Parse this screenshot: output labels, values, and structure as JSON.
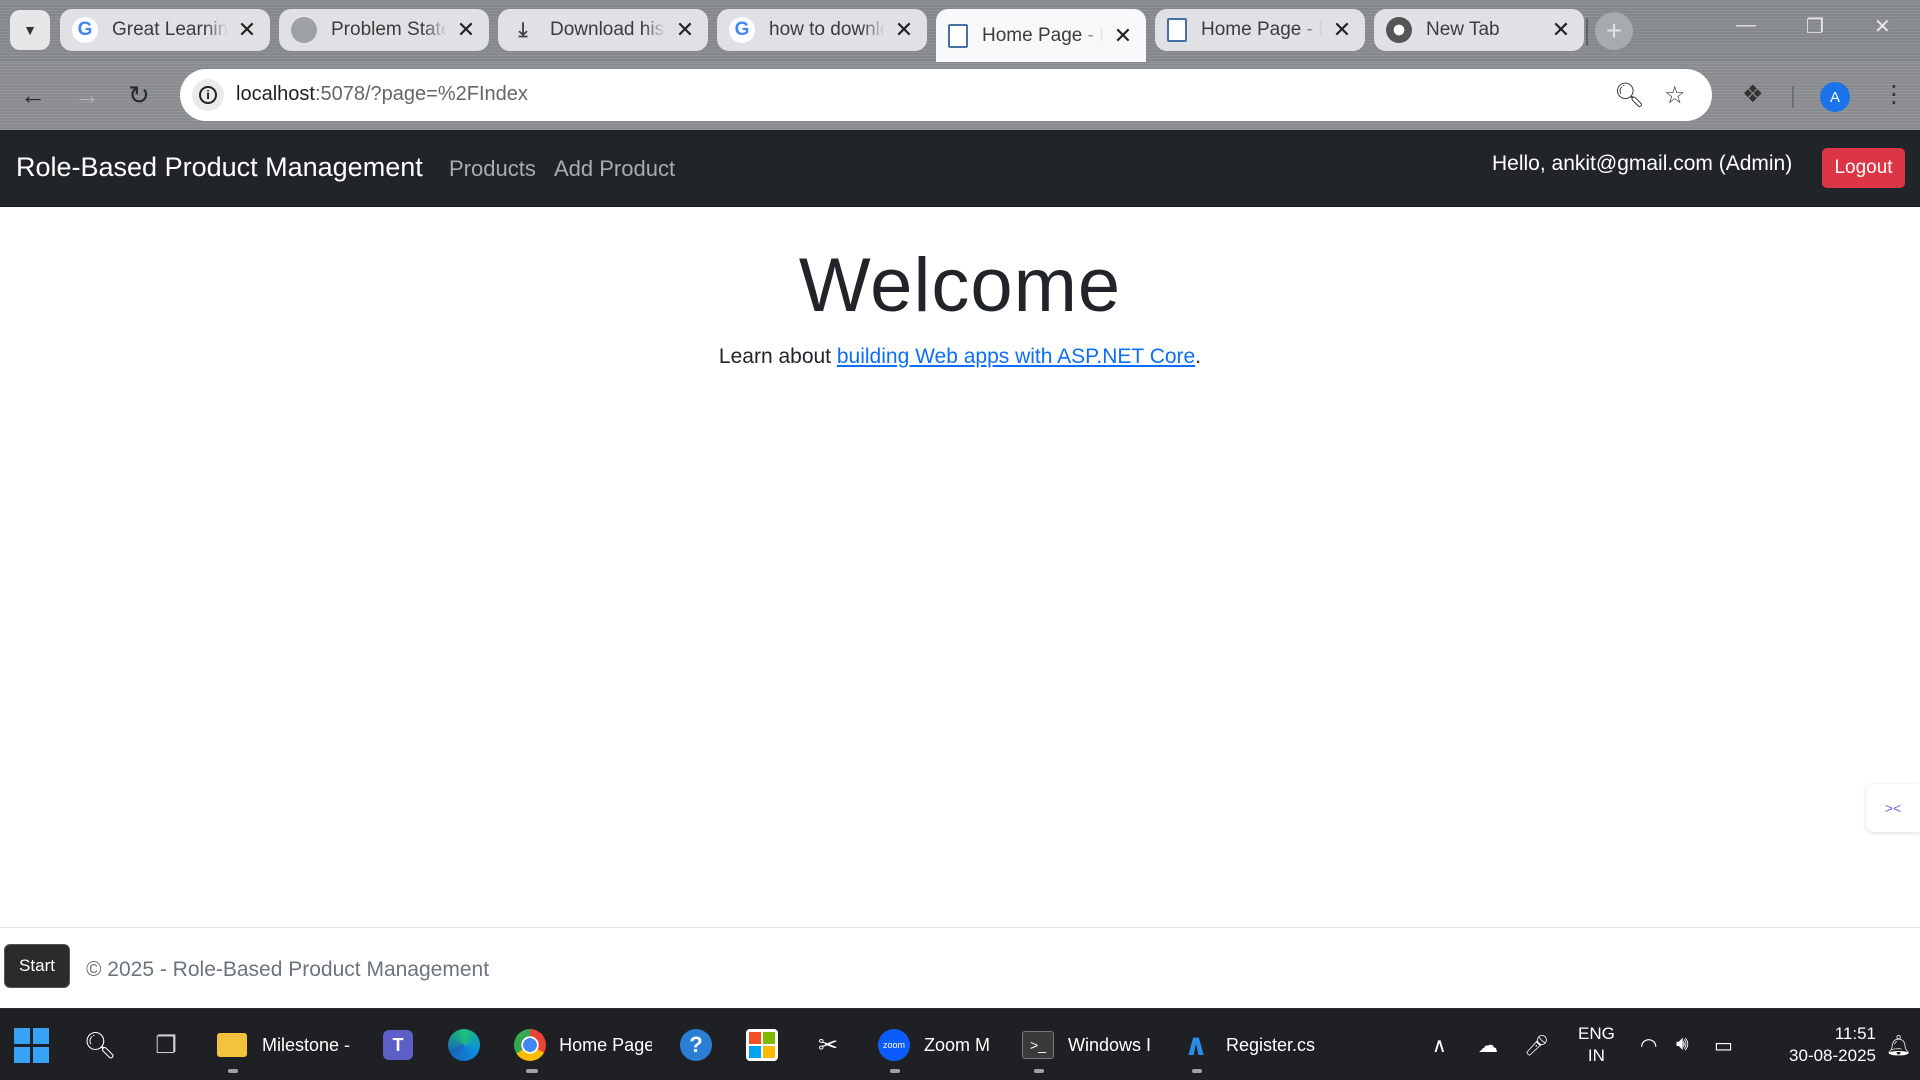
{
  "browser": {
    "tabs": [
      {
        "title": "Great Learning",
        "favicon": "google-icon",
        "active": false
      },
      {
        "title": "Problem Statement",
        "favicon": "globe-icon",
        "active": false
      },
      {
        "title": "Download history",
        "favicon": "download-icon",
        "active": false
      },
      {
        "title": "how to download",
        "favicon": "google-icon",
        "active": false
      },
      {
        "title": "Home Page - Role",
        "favicon": "document-icon",
        "active": true
      },
      {
        "title": "Home Page - Role",
        "favicon": "document-icon",
        "active": false
      },
      {
        "title": "New Tab",
        "favicon": "chrome-icon",
        "active": false
      }
    ],
    "url_host": "localhost",
    "url_rest": ":5078/?page=%2FIndex",
    "avatar_letter": "A"
  },
  "app": {
    "brand": "Role-Based Product Management",
    "nav": {
      "products": "Products",
      "add_product": "Add Product"
    },
    "greeting": "Hello, ankit@gmail.com (Admin)",
    "logout_label": "Logout",
    "colors": {
      "navbar": "#212529",
      "logout": "#dc3545",
      "link": "#0d6efd"
    }
  },
  "main": {
    "heading": "Welcome",
    "learn_prefix": "Learn about ",
    "learn_link": "building Web apps with ASP.NET Core",
    "learn_suffix": "."
  },
  "footer": {
    "text": "© 2025 - Role-Based Product Management"
  },
  "tooltip": {
    "start": "Start"
  },
  "taskbar": {
    "apps": [
      {
        "name": "file-explorer",
        "label": "Milestone -"
      },
      {
        "name": "chrome",
        "label": "Home Page"
      },
      {
        "name": "zoom",
        "label": "Zoom M",
        "glyph": "zoom"
      },
      {
        "name": "terminal",
        "label": "Windows I"
      },
      {
        "name": "vscode",
        "label": "Register.cs"
      }
    ],
    "lang_line1": "ENG",
    "lang_line2": "IN",
    "time": "11:51",
    "date": "30-08-2025"
  }
}
